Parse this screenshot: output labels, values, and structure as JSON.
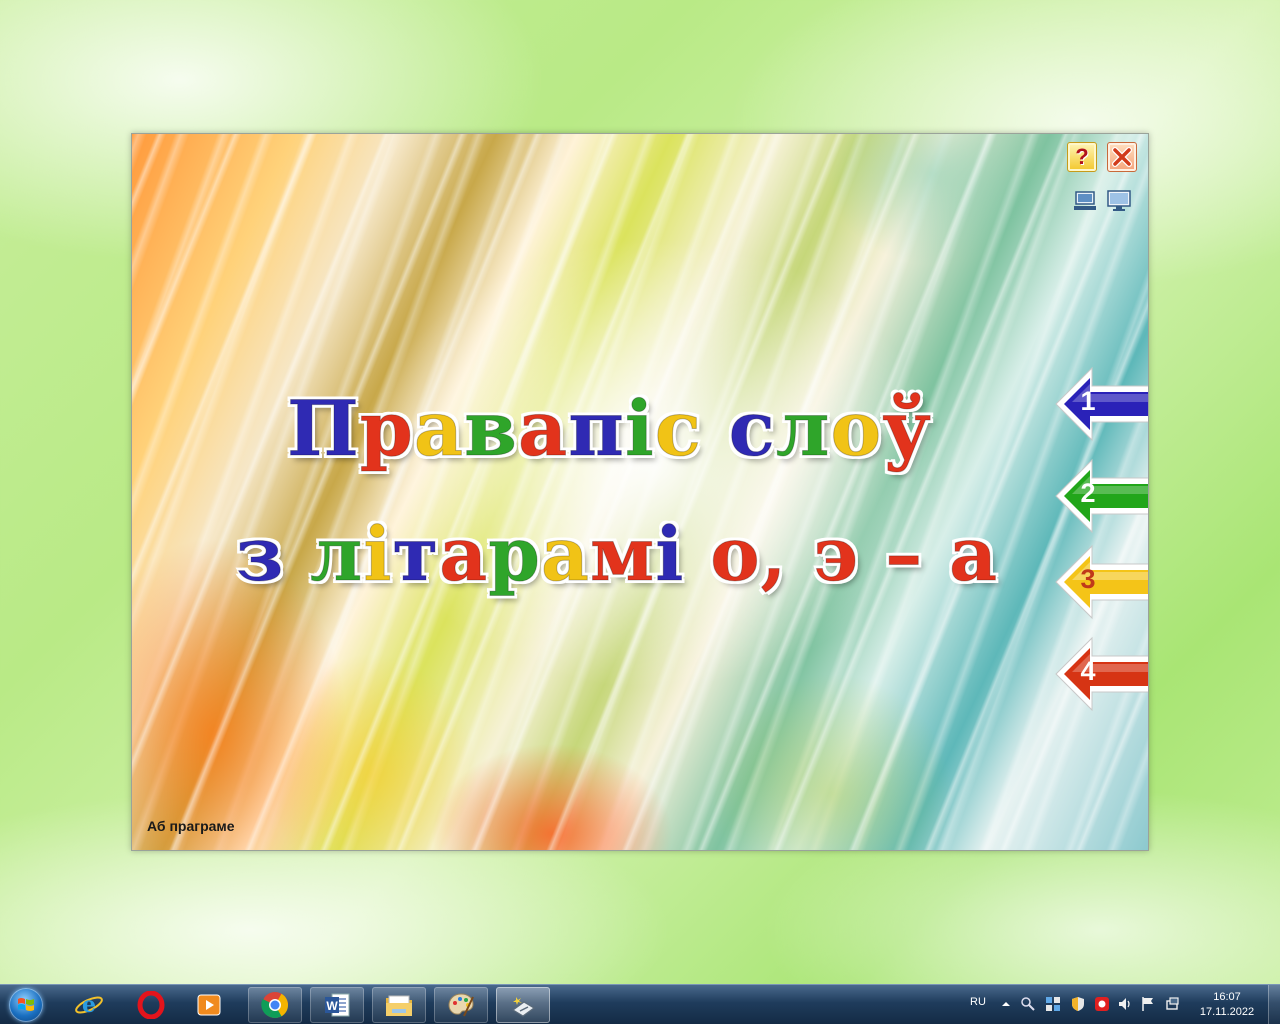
{
  "app": {
    "title_line1": [
      "П",
      "р",
      "а",
      "в",
      "а",
      "п",
      "і",
      "с",
      " ",
      "с",
      "л",
      "о",
      "ў"
    ],
    "title_line2": [
      "з",
      " ",
      "л",
      "і",
      "т",
      "а",
      "р",
      "а",
      "м",
      "і",
      " ",
      "о",
      ",",
      " ",
      "э",
      " ",
      "–",
      " ",
      "а"
    ],
    "help_label": "?",
    "about_link": "Аб праграме",
    "nav_buttons": [
      {
        "label": "1",
        "color": "#2a22b8"
      },
      {
        "label": "2",
        "color": "#22a61a"
      },
      {
        "label": "3",
        "color": "#f4c418"
      },
      {
        "label": "4",
        "color": "#d63414"
      }
    ]
  },
  "taskbar": {
    "language": "RU",
    "clock_time": "16:07",
    "clock_date": "17.11.2022",
    "apps": [
      "internet-explorer",
      "opera",
      "media-player",
      "chrome",
      "word",
      "file-explorer",
      "paint",
      "active-program"
    ]
  }
}
